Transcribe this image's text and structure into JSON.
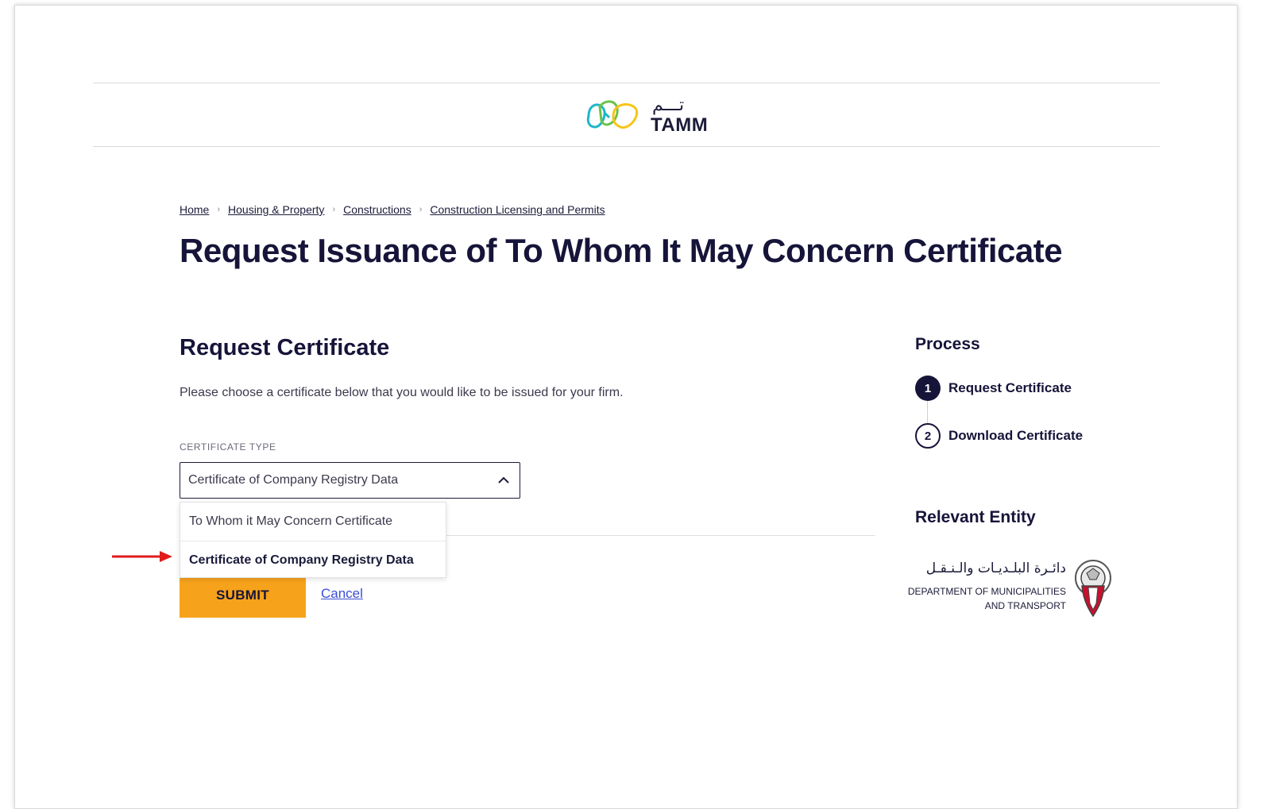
{
  "brand": {
    "logo_arabic": "تـــم",
    "logo_english": "TAMM"
  },
  "breadcrumb": {
    "items": [
      "Home",
      "Housing & Property",
      "Constructions",
      "Construction Licensing and Permits"
    ],
    "separator": "›"
  },
  "page_title": "Request Issuance of To Whom It May Concern Certificate",
  "form": {
    "section_title": "Request Certificate",
    "description": "Please choose a certificate below that you would like to be issued for your firm.",
    "certificate_type_label": "CERTIFICATE TYPE",
    "selected_value": "Certificate of Company Registry Data",
    "options": [
      {
        "label": "To Whom it May Concern Certificate",
        "selected": false
      },
      {
        "label": "Certificate of Company Registry Data",
        "selected": true
      }
    ],
    "submit_label": "SUBMIT",
    "cancel_label": "Cancel"
  },
  "process": {
    "title": "Process",
    "steps": [
      {
        "number": "1",
        "label": "Request Certificate",
        "active": true
      },
      {
        "number": "2",
        "label": "Download Certificate",
        "active": false
      }
    ]
  },
  "entity": {
    "title": "Relevant Entity",
    "name_arabic": "دائـرة البلـديـات والـنـقـل",
    "name_line1": "DEPARTMENT OF MUNICIPALITIES",
    "name_line2": "AND TRANSPORT"
  },
  "colors": {
    "primary_text": "#161439",
    "accent": "#f7a21b",
    "link": "#3a4dd6",
    "annotation_arrow": "#e01b1b"
  },
  "icons": {
    "dropdown": "chevron-up-icon",
    "annotation": "red-arrow-icon",
    "brand": "tamm-logo-icon",
    "emblem": "abu-dhabi-emblem-icon"
  }
}
